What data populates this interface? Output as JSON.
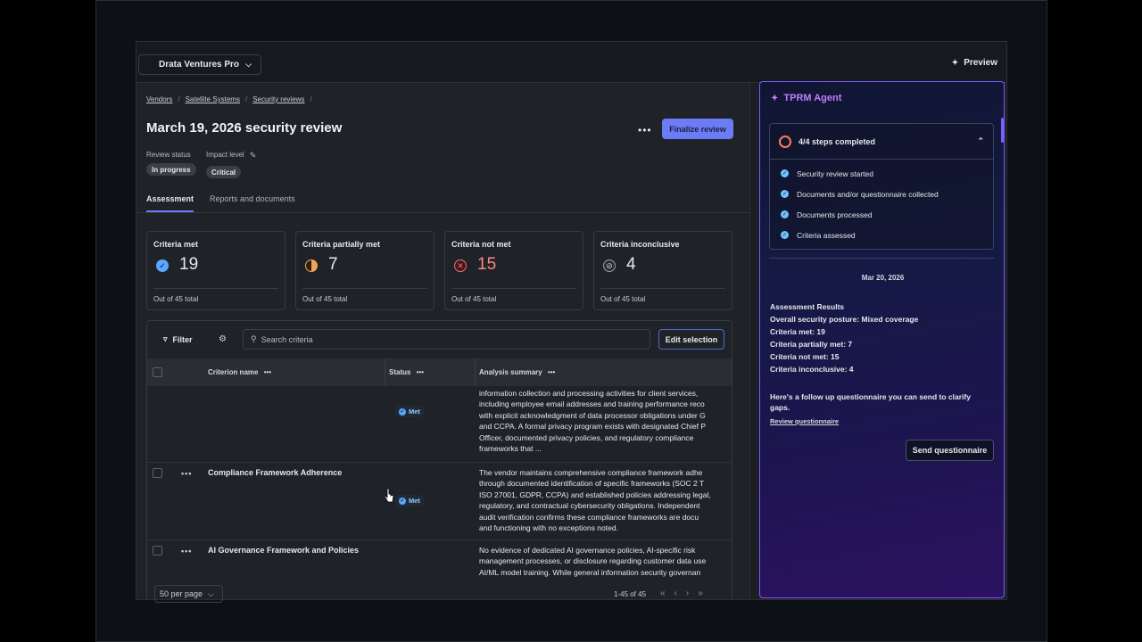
{
  "topbar": {
    "workspace": "Drata Ventures Pro",
    "preview_label": "Preview"
  },
  "breadcrumbs": [
    "Vendors",
    "Satellite Systems",
    "Security reviews"
  ],
  "page": {
    "title": "March 19, 2026 security review",
    "more_label": "•••",
    "finalize_label": "Finalize review",
    "review_status_label": "Review status",
    "review_status_value": "In progress",
    "impact_level_label": "Impact level",
    "impact_level_value": "Critical"
  },
  "tabs": [
    {
      "label": "Assessment"
    },
    {
      "label": "Reports and documents"
    }
  ],
  "cards": [
    {
      "label": "Criteria met",
      "value": "19",
      "footer": "Out of 45 total"
    },
    {
      "label": "Criteria partially met",
      "value": "7",
      "footer": "Out of 45 total"
    },
    {
      "label": "Criteria not met",
      "value": "15",
      "footer": "Out of 45 total"
    },
    {
      "label": "Criteria inconclusive",
      "value": "4",
      "footer": "Out of 45 total"
    }
  ],
  "toolbar": {
    "filter_label": "Filter",
    "search_placeholder": "Search criteria",
    "edit_selection_label": "Edit selection"
  },
  "table": {
    "columns": [
      "Criterion name",
      "Status",
      "Analysis summary"
    ],
    "col_menu": "•••",
    "rows": [
      {
        "name": "",
        "status": "Met",
        "summary": [
          "information collection and processing activities for client services,",
          "including employee email addresses and training performance reco",
          "with explicit acknowledgment of data processor obligations under G",
          "and CCPA. A formal privacy program exists with designated Chief P",
          "Officer, documented privacy policies, and regulatory compliance",
          "frameworks that ..."
        ]
      },
      {
        "name": "Compliance Framework Adherence",
        "status": "Met",
        "summary": [
          "The vendor maintains comprehensive compliance framework adhe",
          "through documented identification of specific frameworks (SOC 2 T",
          "ISO 27001, GDPR, CCPA) and established policies addressing legal,",
          "regulatory, and contractual cybersecurity obligations. Independent",
          "audit verification confirms these compliance frameworks are docu",
          "and functioning with no exceptions noted."
        ]
      },
      {
        "name": "AI Governance Framework and Policies",
        "status": "",
        "summary": [
          "No evidence of dedicated AI governance policies, AI-specific risk",
          "management processes, or disclosure regarding customer data use",
          "AI/ML model training. While general information security governan"
        ]
      }
    ],
    "row_menu": "•••"
  },
  "pagination": {
    "per_page": "50 per page",
    "range": "1-45 of 45",
    "nav": [
      "«",
      "‹",
      "›",
      "»"
    ]
  },
  "agent": {
    "title": "TPRM Agent",
    "steps_summary": "4/4 steps completed",
    "steps": [
      "Security review started",
      "Documents and/or questionnaire collected",
      "Documents processed",
      "Criteria assessed"
    ],
    "date": "Mar 20, 2026",
    "results": [
      "Assessment Results",
      "Overall security posture: Mixed coverage",
      "Criteria met: 19",
      "Criteria partially met: 7",
      "Criteria not met: 15",
      "Criteria inconclusive: 4"
    ],
    "followup": "Here's a follow up questionnaire you can send to clarify gaps.",
    "review_link": "Review questionnaire",
    "send_label": "Send questionnaire"
  },
  "colors": {
    "accent": "#6b7cf6",
    "agent_border": "#7b5cff",
    "met": "#5aa9ff",
    "partial": "#f0a35a",
    "notmet": "#ff6b6b",
    "inconclusive": "#9aa0a8"
  }
}
